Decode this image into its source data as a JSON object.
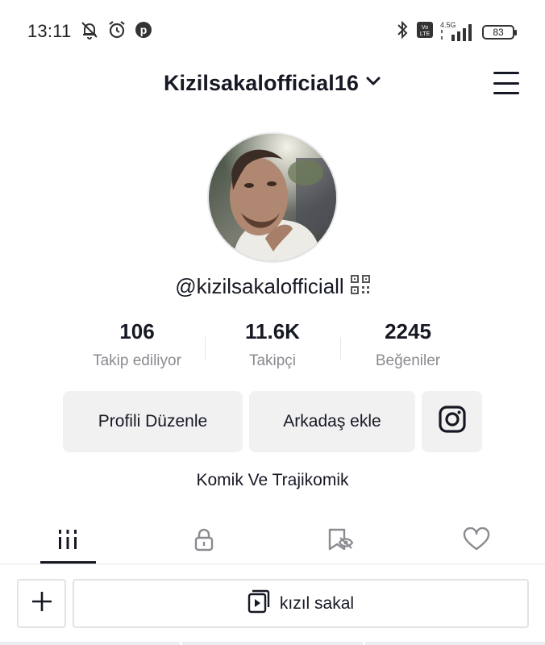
{
  "status_bar": {
    "time": "13:11",
    "left_icons": [
      "bell-muted-icon",
      "alarm-icon",
      "pinterest-icon"
    ],
    "right_icons": [
      "bluetooth-icon",
      "volte-icon",
      "signal-icon"
    ],
    "network_label": "4.5G",
    "volte_label": "Vo LTE",
    "battery": "83"
  },
  "header": {
    "username": "Kizilsakalofficial16",
    "menu_icon": "hamburger-menu-icon"
  },
  "profile": {
    "handle": "@kizilsakalofficiall",
    "bio": "Komik Ve Trajikomik"
  },
  "stats": [
    {
      "value": "106",
      "label": "Takip ediliyor"
    },
    {
      "value": "11.6K",
      "label": "Takipçi"
    },
    {
      "value": "2245",
      "label": "Beğeniler"
    }
  ],
  "actions": {
    "edit_profile": "Profili Düzenle",
    "add_friends": "Arkadaş ekle",
    "instagram_icon": "instagram-icon"
  },
  "tabs": [
    {
      "icon": "videos-grid-icon",
      "active": true
    },
    {
      "icon": "lock-icon",
      "active": false
    },
    {
      "icon": "saved-eye-icon",
      "active": false
    },
    {
      "icon": "heart-icon",
      "active": false
    }
  ],
  "bottom_bar": {
    "playlist_label": "kızıl sakal"
  },
  "colors": {
    "text_primary": "#161823",
    "text_secondary": "#8a8b91",
    "button_bg": "#f1f1f2"
  }
}
